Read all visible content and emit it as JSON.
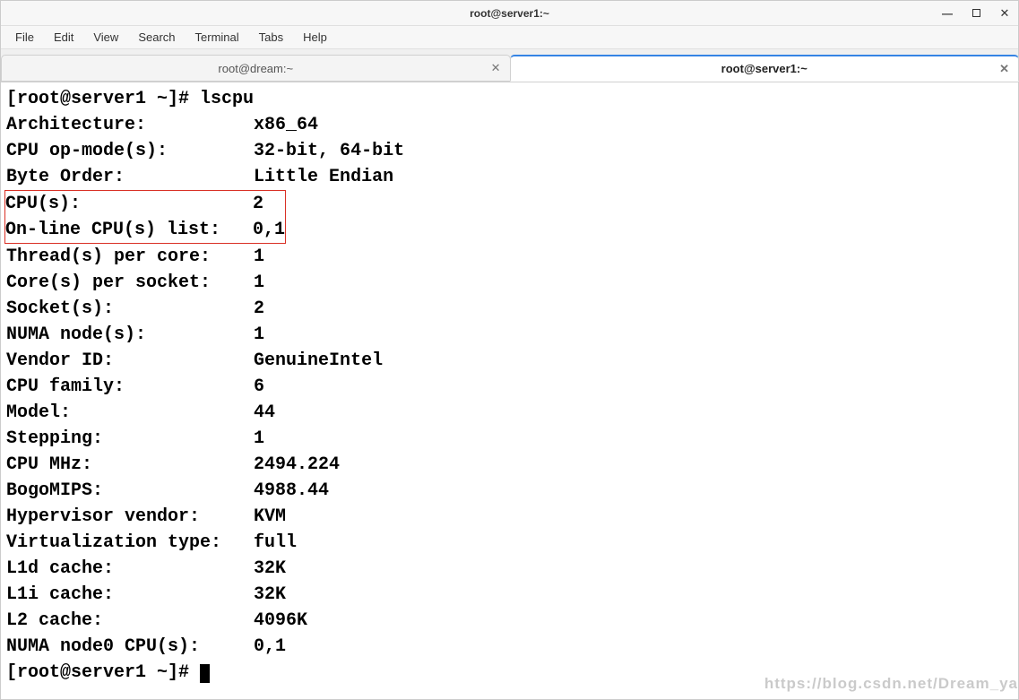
{
  "window": {
    "title": "root@server1:~"
  },
  "menubar": {
    "items": [
      "File",
      "Edit",
      "View",
      "Search",
      "Terminal",
      "Tabs",
      "Help"
    ]
  },
  "tabs": [
    {
      "label": "root@dream:~",
      "active": false
    },
    {
      "label": "root@server1:~",
      "active": true
    }
  ],
  "terminal": {
    "prompt1": "[root@server1 ~]# ",
    "command": "lscpu",
    "rows": [
      {
        "label": "Architecture:",
        "value": "x86_64"
      },
      {
        "label": "CPU op-mode(s):",
        "value": "32-bit, 64-bit"
      },
      {
        "label": "Byte Order:",
        "value": "Little Endian"
      },
      {
        "label": "CPU(s):",
        "value": "2",
        "highlight": true
      },
      {
        "label": "On-line CPU(s) list:",
        "value": "0,1",
        "highlight": true
      },
      {
        "label": "Thread(s) per core:",
        "value": "1"
      },
      {
        "label": "Core(s) per socket:",
        "value": "1"
      },
      {
        "label": "Socket(s):",
        "value": "2"
      },
      {
        "label": "NUMA node(s):",
        "value": "1"
      },
      {
        "label": "Vendor ID:",
        "value": "GenuineIntel"
      },
      {
        "label": "CPU family:",
        "value": "6"
      },
      {
        "label": "Model:",
        "value": "44"
      },
      {
        "label": "Stepping:",
        "value": "1"
      },
      {
        "label": "CPU MHz:",
        "value": "2494.224"
      },
      {
        "label": "BogoMIPS:",
        "value": "4988.44"
      },
      {
        "label": "Hypervisor vendor:",
        "value": "KVM"
      },
      {
        "label": "Virtualization type:",
        "value": "full"
      },
      {
        "label": "L1d cache:",
        "value": "32K"
      },
      {
        "label": "L1i cache:",
        "value": "32K"
      },
      {
        "label": "L2 cache:",
        "value": "4096K"
      },
      {
        "label": "NUMA node0 CPU(s):",
        "value": "0,1"
      }
    ],
    "prompt2": "[root@server1 ~]# ",
    "label_col_width": 21
  },
  "watermark": "https://blog.csdn.net/Dream_ya"
}
